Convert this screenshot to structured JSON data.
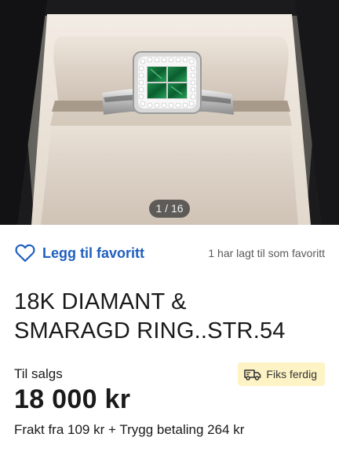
{
  "gallery": {
    "counter": "1 / 16"
  },
  "favorite": {
    "label": "Legg til favoritt",
    "count_text": "1 har lagt til som favoritt",
    "icon": "heart-outline-icon",
    "accent_color": "#1f5fc0"
  },
  "listing": {
    "title_line1": "18K DIAMANT &",
    "title_line2": "SMARAGD RING..STR.54",
    "status": "Til salgs",
    "badge": {
      "label": "Fiks ferdig",
      "icon": "delivery-truck-icon",
      "background": "#fdf3c4"
    },
    "price": "18 000 kr",
    "shipping": "Frakt fra 109 kr + Trygg betaling 264 kr"
  }
}
